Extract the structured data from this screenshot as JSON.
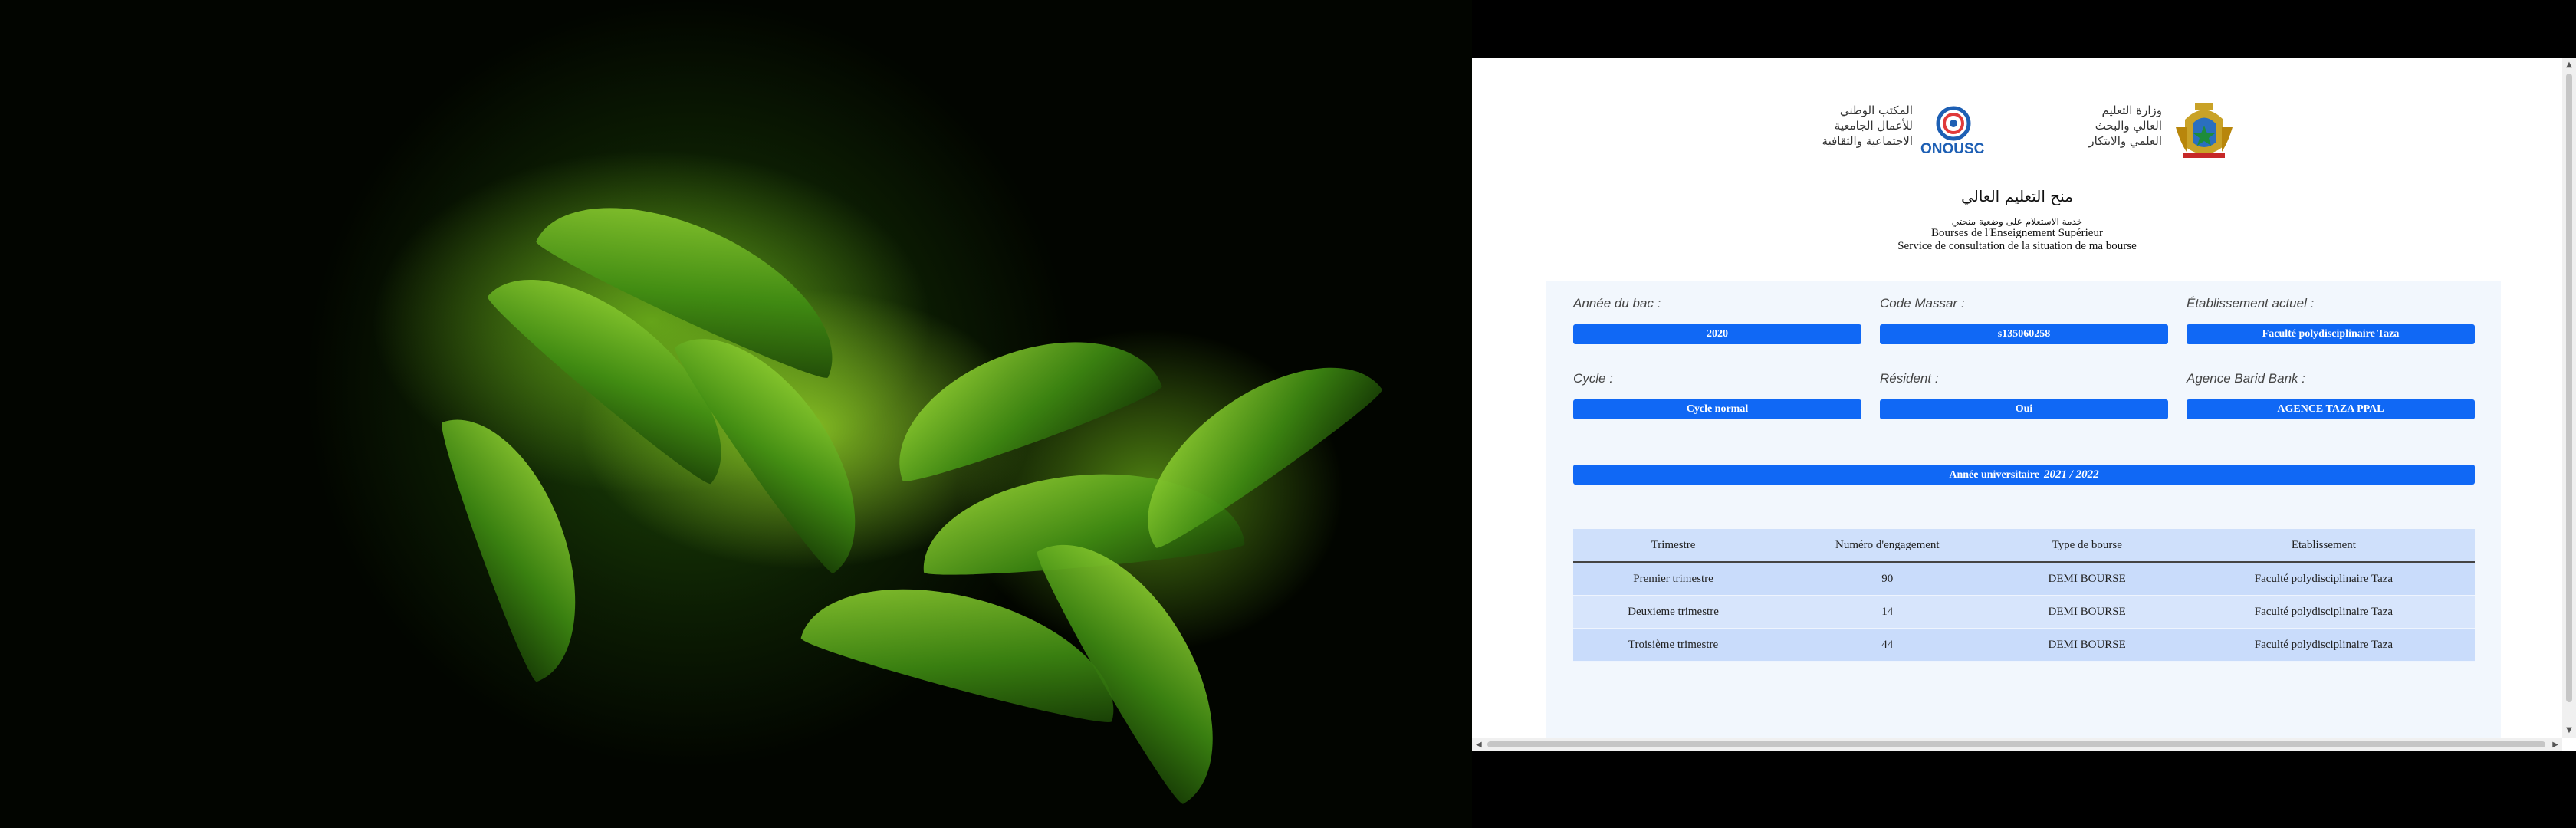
{
  "header": {
    "onousc_arabic_lines": [
      "المكتب الوطني",
      "للأعمال الجامعية",
      "الاجتماعية والثقافية"
    ],
    "onousc_name": "ONOUSC",
    "ministry_arabic_lines": [
      "وزارة التعليم",
      "العالي والبحث",
      "العلمي والابتكار"
    ]
  },
  "titles": {
    "arabic_title": "منح التعليم العالي",
    "arabic_subtitle": "خدمة الاستعلام على وضعية منحتي",
    "french_title": "Bourses de l'Enseignement Supérieur",
    "french_subtitle": "Service de consultation de la situation de ma bourse"
  },
  "fields": {
    "bac_year": {
      "label": "Année du bac :",
      "value": "2020"
    },
    "code_massar": {
      "label": "Code Massar :",
      "value": "s135060258"
    },
    "establishment": {
      "label": "Établissement actuel :",
      "value": "Faculté polydisciplinaire Taza"
    },
    "cycle": {
      "label": "Cycle :",
      "value": "Cycle normal"
    },
    "resident": {
      "label": "Résident :",
      "value": "Oui"
    },
    "agency": {
      "label": "Agence Barid Bank :",
      "value": "AGENCE TAZA PPAL"
    }
  },
  "academic_year": {
    "label": "Année universitaire",
    "value": "2021 / 2022"
  },
  "table": {
    "headers": [
      "Trimestre",
      "Numéro d'engagement",
      "Type de bourse",
      "Etablissement"
    ],
    "rows": [
      [
        "Premier trimestre",
        "90",
        "DEMI BOURSE",
        "Faculté polydisciplinaire Taza"
      ],
      [
        "Deuxieme trimestre",
        "14",
        "DEMI BOURSE",
        "Faculté polydisciplinaire Taza"
      ],
      [
        "Troisième trimestre",
        "44",
        "DEMI BOURSE",
        "Faculté polydisciplinaire Taza"
      ]
    ]
  },
  "colors": {
    "accent": "#1068f5",
    "panel": "#f2f7fd",
    "table_header": "#cfe0fb"
  }
}
